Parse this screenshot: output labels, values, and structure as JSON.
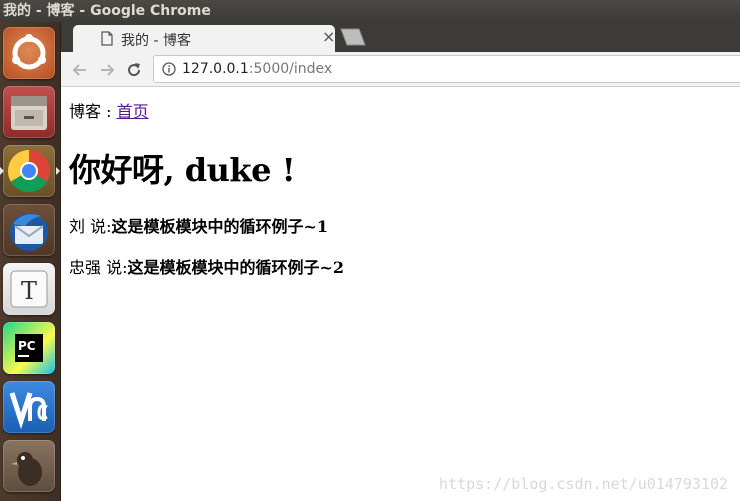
{
  "os": {
    "window_title": "我的 - 博客 - Google Chrome"
  },
  "launcher": {
    "items": [
      {
        "name": "ubuntu-dash-icon",
        "color": "#d2682f"
      },
      {
        "name": "files-icon",
        "color": "#b44"
      },
      {
        "name": "chrome-icon",
        "color": "#4285f4",
        "active": true
      },
      {
        "name": "thunderbird-icon",
        "color": "#2c6aa8"
      },
      {
        "name": "text-editor-icon",
        "color": "#e8e8e8"
      },
      {
        "name": "pycharm-icon",
        "color": "#21d789"
      },
      {
        "name": "vnc-icon",
        "color": "#2a7bd4"
      },
      {
        "name": "gimp-icon",
        "color": "#6d5a4a"
      }
    ]
  },
  "browser": {
    "tab_title": "我的 - 博客",
    "tab_close": "×",
    "url_host": "127.0.0.1",
    "url_rest": ":5000/index"
  },
  "page": {
    "nav_prefix": "博客 : ",
    "nav_link": "首页",
    "greeting": "你好呀, duke !",
    "posts": [
      {
        "author": "刘 说:",
        "body": "这是模板模块中的循环例子~1"
      },
      {
        "author": "忠强 说:",
        "body": "这是模板模块中的循环例子~2"
      }
    ],
    "watermark": "https://blog.csdn.net/u014793102"
  }
}
